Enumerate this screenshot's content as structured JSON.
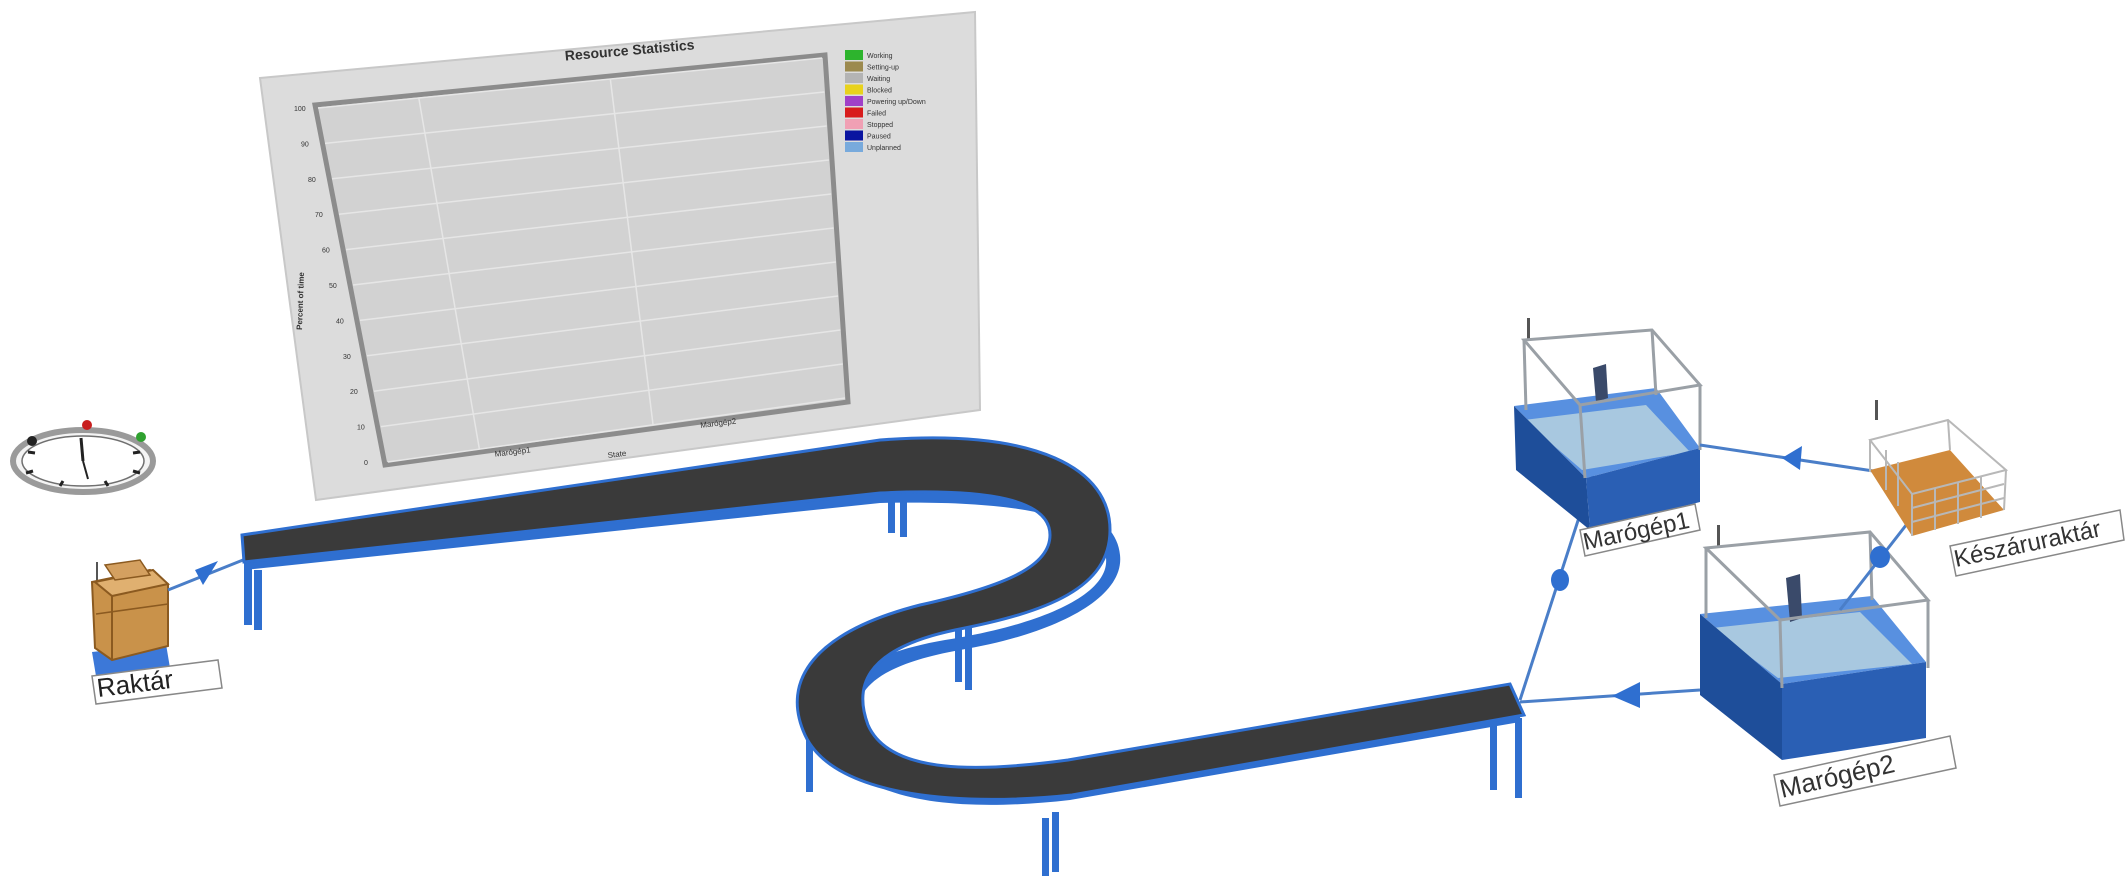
{
  "chart_data": {
    "type": "bar",
    "title": "Resource Statistics",
    "xlabel": "State",
    "ylabel": "Percent of time",
    "categories": [
      "Marógép1",
      "Marógép2"
    ],
    "ylim": [
      0,
      100
    ],
    "yticks": [
      "0",
      "10",
      "20",
      "30",
      "40",
      "50",
      "60",
      "70",
      "80",
      "90",
      "100"
    ],
    "series": [],
    "grid": true,
    "legend_position": "right",
    "legend": [
      {
        "label": "Working",
        "color": "#2db42d"
      },
      {
        "label": "Setting-up",
        "color": "#9c8a4e"
      },
      {
        "label": "Waiting",
        "color": "#b4b4b4"
      },
      {
        "label": "Blocked",
        "color": "#e8d21c"
      },
      {
        "label": "Powering up/Down",
        "color": "#a040c8"
      },
      {
        "label": "Failed",
        "color": "#d81c1c"
      },
      {
        "label": "Stopped",
        "color": "#f0a0b4"
      },
      {
        "label": "Paused",
        "color": "#0a14a0"
      },
      {
        "label": "Unplanned",
        "color": "#78aadc"
      }
    ]
  },
  "labels": {
    "raktar": "Raktár",
    "marogep1": "Marógép1",
    "marogep2": "Marógép2",
    "keszaruraktar": "Készáruraktár"
  },
  "colors": {
    "conveyor_belt": "#3a3a3a",
    "conveyor_frame": "#2f6fd0",
    "machine_body": "#2a5fb4",
    "connector": "#4a7ec8"
  }
}
